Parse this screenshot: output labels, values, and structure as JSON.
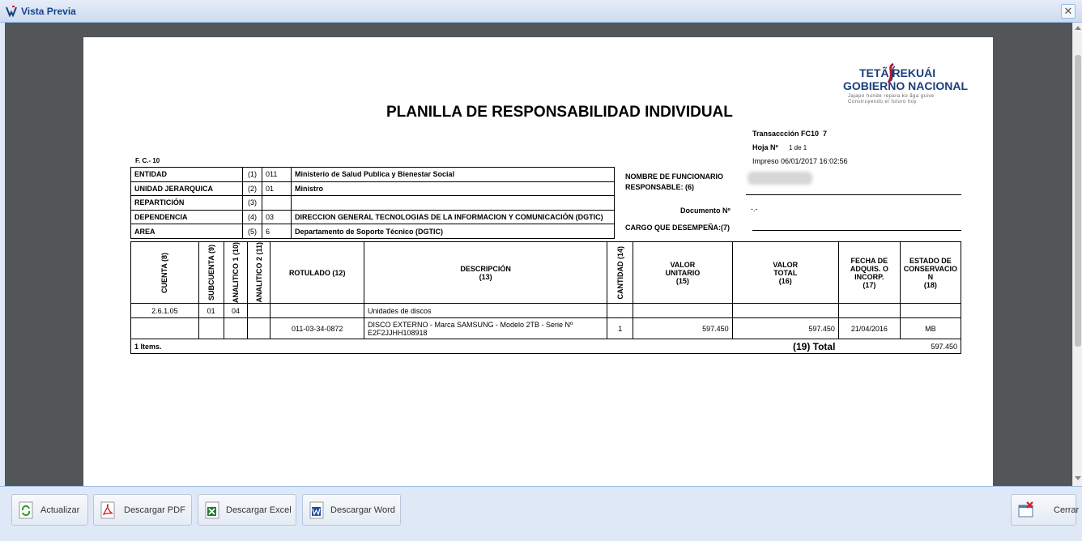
{
  "window": {
    "title": "Vista Previa",
    "close_glyph": "✕"
  },
  "document": {
    "title": "PLANILLA DE RESPONSABILIDAD INDIVIDUAL",
    "form_code": "F. C.- 10",
    "logo": {
      "line1": "TETÃ REKUÁI",
      "line2": "GOBIERNO NACIONAL",
      "line3": "Jajapo hunde repara ko ãga guive",
      "line4": "Construyendo el futuro hoy"
    },
    "transaction": {
      "label": "Transaccción FC10",
      "value": "7"
    },
    "sheet": {
      "label": "Hoja Nº",
      "value": "1 de 1"
    },
    "printed": "Impreso 06/01/2017  16:02:56",
    "entity_rows": [
      {
        "label": "ENTIDAD",
        "num": "(1)",
        "code": "011",
        "value": "Ministerio de Salud Publica y Bienestar Social"
      },
      {
        "label": "UNIDAD JERARQUICA",
        "num": "(2)",
        "code": "01",
        "value": "Ministro"
      },
      {
        "label": "REPARTICIÓN",
        "num": "(3)",
        "code": "",
        "value": ""
      },
      {
        "label": "DEPENDENCIA",
        "num": "(4)",
        "code": "03",
        "value": "DIRECCION GENERAL TECNOLOGIAS DE LA INFORMACION Y COMUNICACIÓN (DGTIC)"
      },
      {
        "label": "AREA",
        "num": "(5)",
        "code": "6",
        "value": "Departamento de Soporte Técnico (DGTIC)"
      }
    ],
    "responsible": {
      "label_line1": "NOMBRE DE FUNCIONARIO",
      "label_line2": "RESPONSABLE: (6)",
      "document_label": "Documento Nº",
      "document_value": "-.-",
      "position_label": "CARGO QUE DESEMPEÑA:(7)"
    },
    "items_headers": {
      "cuenta": "CUENTA (8)",
      "subcuenta": "SUBCUENTA (9)",
      "analitico1": "ANALITICO 1 (10)",
      "analitico2": "ANALITICO 2 (11)",
      "rotulado": "ROTULADO (12)",
      "descripcion": "DESCRIPCIÓN",
      "descripcion_num": "(13)",
      "cantidad": "CANTIDAD (14)",
      "valor_unitario_1": "VALOR",
      "valor_unitario_2": "UNITARIO",
      "valor_unitario_3": "(15)",
      "valor_total_1": "VALOR",
      "valor_total_2": "TOTAL",
      "valor_total_3": "(16)",
      "fecha_1": "FECHA DE",
      "fecha_2": "ADQUIS. O",
      "fecha_3": "INCORP.",
      "fecha_4": "(17)",
      "estado_1": "ESTADO DE",
      "estado_2": "CONSERVACIO",
      "estado_3": "N",
      "estado_4": "(18)"
    },
    "group_row": {
      "cuenta": "2.6.1.05",
      "subcuenta": "01",
      "analitico1": "04",
      "descripcion": "Unidades de discos"
    },
    "item_row": {
      "rotulado": "011-03-34-0872",
      "descripcion_line1": "DISCO EXTERNO - Marca SAMSUNG - Modelo 2TB - Serie Nº",
      "descripcion_line2": "E2F2JJHH108918",
      "cantidad": "1",
      "valor_unitario": "597.450",
      "valor_total": "597.450",
      "fecha": "21/04/2016",
      "estado": "MB"
    },
    "footer_row": {
      "items": "1 Items.",
      "total_label": "(19) Total",
      "total_value": "597.450"
    }
  },
  "toolbar": {
    "refresh": "Actualizar",
    "pdf": "Descargar PDF",
    "excel": "Descargar Excel",
    "word": "Descargar Word",
    "close": "Cerrar"
  }
}
